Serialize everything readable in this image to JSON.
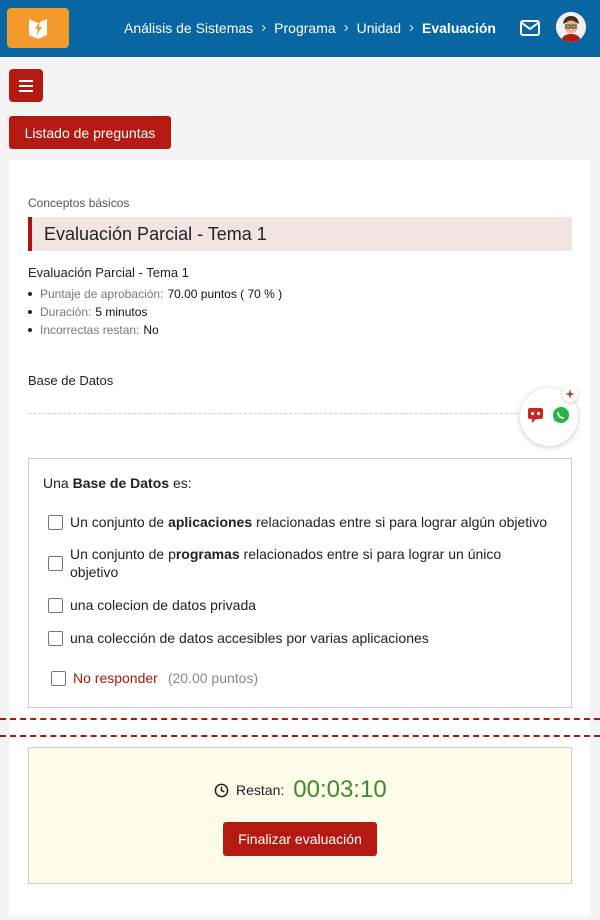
{
  "header": {
    "logo_icon": "lightning-book-icon",
    "breadcrumbs": [
      "Análisis de Sistemas",
      "Programa",
      "Unidad",
      "Evaluación"
    ],
    "mail_icon": "mail-icon",
    "avatar_icon": "user-avatar"
  },
  "toolbar": {
    "menu_icon": "hamburger-icon",
    "list_button": "Listado de preguntas"
  },
  "exam": {
    "category": "Conceptos básicos",
    "title": "Evaluación Parcial - Tema 1",
    "subtitle": "Evaluación Parcial - Tema 1",
    "info": [
      {
        "label": "Puntaje de aprobación:",
        "value": "70.00 puntos ( 70 % )"
      },
      {
        "label": "Duración:",
        "value": "5 minutos"
      },
      {
        "label": "Incorrectas restan:",
        "value": "No"
      }
    ],
    "section": "Base de Datos"
  },
  "question": {
    "stem_pre": "Una ",
    "stem_bold": "Base de Datos",
    "stem_post": " es:",
    "options": [
      {
        "pre": "Un conjunto de ",
        "bold": "aplicaciones",
        "post": " relacionadas entre si para lograr algún objetivo"
      },
      {
        "pre": "Un conjunto de p",
        "bold": "rogramas",
        "post": " relacionados entre si para lograr un único objetivo"
      },
      {
        "pre": "una colecion de datos privada",
        "bold": "",
        "post": ""
      },
      {
        "pre": "una colección de datos accesibles por varias aplicaciones",
        "bold": "",
        "post": ""
      }
    ],
    "no_answer_label": "No responder",
    "no_answer_points": "(20.00 puntos)"
  },
  "timer": {
    "label": "Restan:",
    "value": "00:03:10",
    "finish_button": "Finalizar evaluación"
  },
  "colors": {
    "header_blue": "#0866a3",
    "brand_orange": "#f39a2b",
    "accent_red": "#b41a12",
    "timer_green": "#3d8a2a"
  }
}
